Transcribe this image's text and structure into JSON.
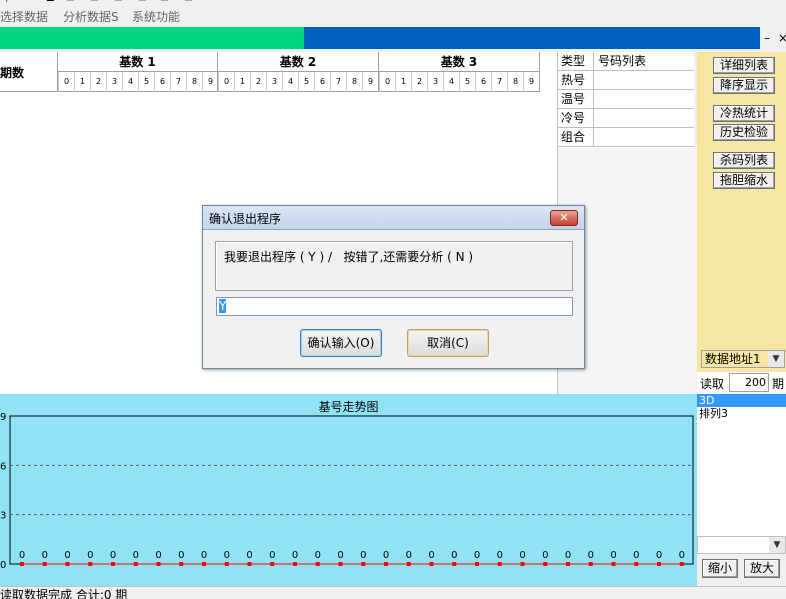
{
  "toolbar": {
    "menus": [
      "选择数据",
      "分析数据S",
      "系统功能"
    ]
  },
  "progress": {
    "fill_fraction": 0.4
  },
  "window_controls": {
    "minimize": "–",
    "close": "×"
  },
  "grid": {
    "period_label": "期数",
    "groups": [
      {
        "title": "基数 1",
        "digits": [
          "0",
          "1",
          "2",
          "3",
          "4",
          "5",
          "6",
          "7",
          "8",
          "9"
        ]
      },
      {
        "title": "基数 2",
        "digits": [
          "0",
          "1",
          "2",
          "3",
          "4",
          "5",
          "6",
          "7",
          "8",
          "9"
        ]
      },
      {
        "title": "基数 3",
        "digits": [
          "0",
          "1",
          "2",
          "3",
          "4",
          "5",
          "6",
          "7",
          "8",
          "9"
        ]
      }
    ]
  },
  "type_table": {
    "headers": [
      "类型",
      "号码列表"
    ],
    "rows": [
      {
        "type": "热号",
        "list": ""
      },
      {
        "type": "温号",
        "list": ""
      },
      {
        "type": "冷号",
        "list": ""
      },
      {
        "type": "组合",
        "list": ""
      }
    ]
  },
  "right_panel": {
    "buttons": [
      "详细列表",
      "降序显示",
      "冷热统计",
      "历史检验",
      "杀码列表",
      "拖胆缩水"
    ],
    "address_select": "数据地址1",
    "read_label": "读取",
    "read_value": "200",
    "read_unit": "期"
  },
  "chart_data": {
    "type": "line",
    "title": "基号走势图",
    "ylim": [
      0,
      9
    ],
    "yticks": [
      "0",
      "3",
      "6",
      "9"
    ],
    "x": [
      1,
      2,
      3,
      4,
      5,
      6,
      7,
      8,
      9,
      10,
      11,
      12,
      13,
      14,
      15,
      16,
      17,
      18,
      19,
      20,
      21,
      22,
      23,
      24,
      25,
      26,
      27,
      28,
      29,
      30
    ],
    "series": [
      {
        "values": [
          0,
          0,
          0,
          0,
          0,
          0,
          0,
          0,
          0,
          0,
          0,
          0,
          0,
          0,
          0,
          0,
          0,
          0,
          0,
          0,
          0,
          0,
          0,
          0,
          0,
          0,
          0,
          0,
          0,
          0
        ]
      }
    ],
    "grid": true,
    "colors": {
      "background": "#8fe3f5",
      "line": "#ff0000",
      "grid": "#606060"
    }
  },
  "list_box": {
    "items": [
      "3D",
      "排列3"
    ],
    "selected_index": 0
  },
  "zoom": {
    "shrink": "缩小",
    "enlarge": "放大"
  },
  "status": {
    "text": "读取数据完成 合计:0 期"
  },
  "dialog": {
    "title": "确认退出程序",
    "close": "✕",
    "message": "我要退出程序 ( Y ) /   按错了,还需要分析 ( N )",
    "input_value": "Y",
    "ok_label": "确认输入(O)",
    "cancel_label": "取消(C)"
  }
}
